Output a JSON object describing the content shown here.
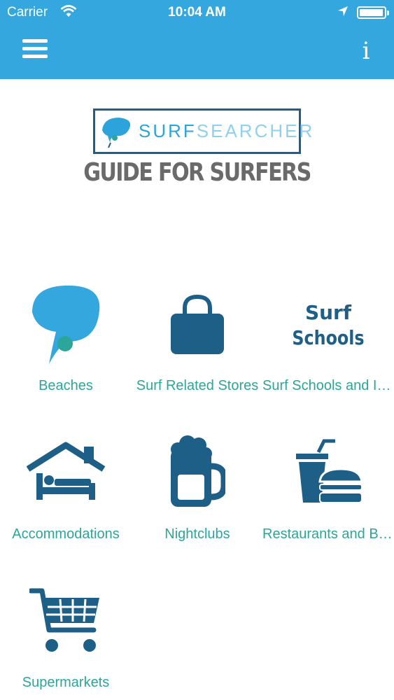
{
  "status_bar": {
    "carrier": "Carrier",
    "time": "10:04 AM"
  },
  "nav": {
    "menu_icon": "hamburger-menu-icon",
    "info_label": "i"
  },
  "logo": {
    "text_part1": "SURF",
    "text_part2": "SEARCHER",
    "tagline": "GUIDE FOR SURFERS"
  },
  "colors": {
    "header": "#34a7de",
    "icon": "#1d5f87",
    "label": "#2ca59a",
    "logo_accent": "#2da3dc",
    "tagline": "#6a6a6a"
  },
  "categories": [
    {
      "label": "Beaches",
      "icon": "wave-icon"
    },
    {
      "label": "Surf Related Stores",
      "icon": "shopping-bag-icon"
    },
    {
      "label": "Surf Schools and Instructors",
      "icon": "surf-schools-icon",
      "icon_text_1": "Surf",
      "icon_text_2": "Schools"
    },
    {
      "label": "Accommodations",
      "icon": "house-bed-icon"
    },
    {
      "label": "Nightclubs",
      "icon": "beer-mug-icon"
    },
    {
      "label": "Restaurants and Bars",
      "icon": "drink-burger-icon"
    },
    {
      "label": "Supermarkets",
      "icon": "shopping-cart-icon"
    }
  ]
}
